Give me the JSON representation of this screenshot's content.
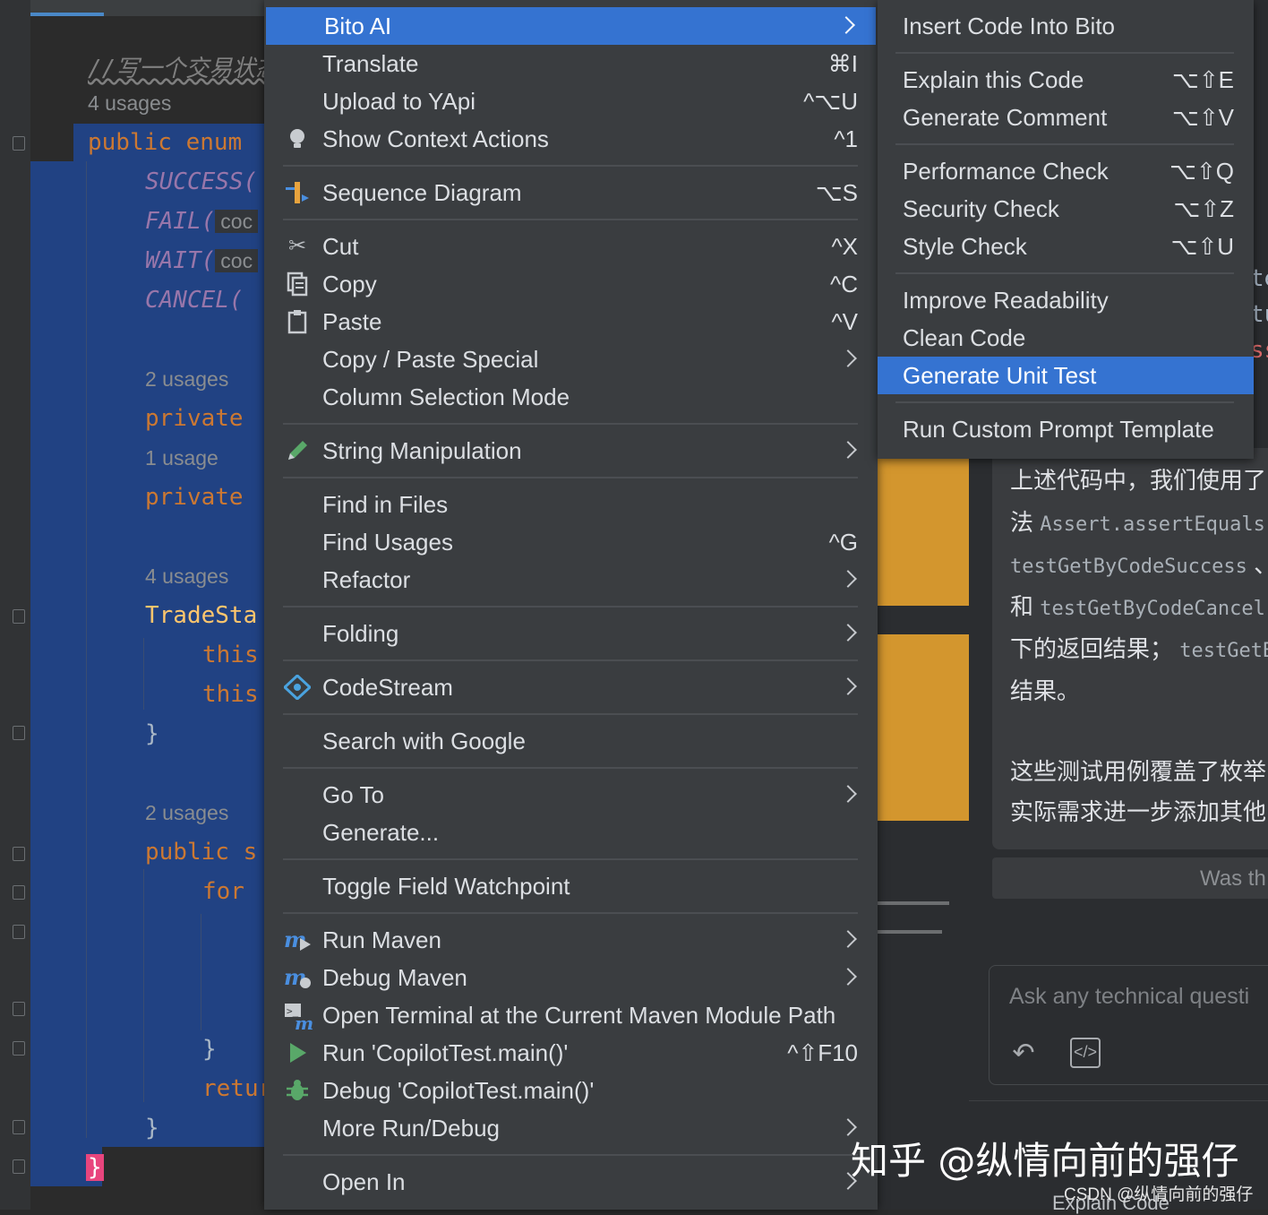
{
  "editor": {
    "comment": "//写一个交易状态",
    "usages": [
      "4 usages",
      "2 usages",
      "1 usage",
      "4 usages",
      "2 usages"
    ],
    "kw_public": "public",
    "kw_enum": "enum",
    "const_success": "SUCCESS(",
    "const_fail": "FAIL(",
    "const_wait": "WAIT(",
    "const_cancel": "CANCEL(",
    "hint_code": "coc",
    "kw_private": "private",
    "class_fragment": "TradeSta",
    "kw_this": "this",
    "kw_for": "for",
    "kw_return": "retur",
    "kw_public_s": "public s",
    "brace_close": "}"
  },
  "context_menu": {
    "items": [
      {
        "label": "Bito AI",
        "shortcut": "",
        "icon": "",
        "submenu": true
      },
      {
        "label": "Translate",
        "shortcut": "⌘I",
        "icon": ""
      },
      {
        "label": "Upload to YApi",
        "shortcut": "^⌥U",
        "icon": ""
      },
      {
        "label": "Show Context Actions",
        "shortcut": "^1",
        "icon": "lightbulb-icon"
      },
      {
        "label": "Sequence Diagram",
        "shortcut": "⌥S",
        "icon": "sequence-diagram-icon"
      },
      {
        "label": "Cut",
        "shortcut": "^X",
        "icon": "scissors-icon"
      },
      {
        "label": "Copy",
        "shortcut": "^C",
        "icon": "copy-icon"
      },
      {
        "label": "Paste",
        "shortcut": "^V",
        "icon": "clipboard-icon"
      },
      {
        "label": "Copy / Paste Special",
        "shortcut": "",
        "icon": "",
        "submenu": true
      },
      {
        "label": "Column Selection Mode",
        "shortcut": "",
        "icon": ""
      },
      {
        "label": "String Manipulation",
        "shortcut": "",
        "icon": "pencil-icon",
        "submenu": true
      },
      {
        "label": "Find in Files",
        "shortcut": "",
        "icon": ""
      },
      {
        "label": "Find Usages",
        "shortcut": "^G",
        "icon": ""
      },
      {
        "label": "Refactor",
        "shortcut": "",
        "icon": "",
        "submenu": true
      },
      {
        "label": "Folding",
        "shortcut": "",
        "icon": "",
        "submenu": true
      },
      {
        "label": "CodeStream",
        "shortcut": "",
        "icon": "codestream-icon",
        "submenu": true
      },
      {
        "label": "Search with Google",
        "shortcut": "",
        "icon": ""
      },
      {
        "label": "Go To",
        "shortcut": "",
        "icon": "",
        "submenu": true
      },
      {
        "label": "Generate...",
        "shortcut": "",
        "icon": ""
      },
      {
        "label": "Toggle Field Watchpoint",
        "shortcut": "",
        "icon": ""
      },
      {
        "label": "Run Maven",
        "shortcut": "",
        "icon": "maven-run-icon",
        "submenu": true
      },
      {
        "label": "Debug Maven",
        "shortcut": "",
        "icon": "maven-debug-icon",
        "submenu": true
      },
      {
        "label": "Open Terminal at the Current Maven Module Path",
        "shortcut": "",
        "icon": "maven-terminal-icon"
      },
      {
        "label": "Run 'CopilotTest.main()'",
        "shortcut": "^⇧F10",
        "icon": "run-icon"
      },
      {
        "label": "Debug 'CopilotTest.main()'",
        "shortcut": "",
        "icon": "debug-bug-icon"
      },
      {
        "label": "More Run/Debug",
        "shortcut": "",
        "icon": "",
        "submenu": true
      },
      {
        "label": "Open In",
        "shortcut": "",
        "icon": "",
        "submenu": true
      }
    ]
  },
  "bito_submenu": {
    "items": [
      {
        "label": "Insert Code Into Bito",
        "shortcut": ""
      },
      {
        "label": "Explain this Code",
        "shortcut": "⌥⇧E"
      },
      {
        "label": "Generate Comment",
        "shortcut": "⌥⇧V"
      },
      {
        "label": "Performance Check",
        "shortcut": "⌥⇧Q"
      },
      {
        "label": "Security Check",
        "shortcut": "⌥⇧Z"
      },
      {
        "label": "Style Check",
        "shortcut": "⌥⇧U"
      },
      {
        "label": "Improve Readability",
        "shortcut": ""
      },
      {
        "label": "Clean Code",
        "shortcut": ""
      },
      {
        "label": "Generate Unit Test",
        "shortcut": ""
      },
      {
        "label": "Run Custom Prompt Template",
        "shortcut": ""
      }
    ]
  },
  "bito_panel": {
    "answer_lines": {
      "l1": "上述代码中，我们使用了",
      "l2_pre": "法",
      "l2_code": "Assert.assertEquals",
      "l3_code": "testGetByCodeSuccess",
      "l3_post": "、",
      "l4_pre": "和",
      "l4_code": "testGetByCodeCancel",
      "l5_pre": "下的返回结果；",
      "l5_code": "testGetB",
      "l6": "结果。",
      "l7": "这些测试用例覆盖了枚举",
      "l8": "实际需求进一步添加其他"
    },
    "feedback_text": "Was th",
    "ask_placeholder": "Ask any technical questi",
    "side_fragments": [
      "te",
      "tu",
      "ss"
    ],
    "explain_code_label": "Explain Code"
  },
  "watermark": {
    "zhihu": "知乎 @纵情向前的强仔",
    "csdn": "CSDN @纵情向前的强仔"
  },
  "colors": {
    "menu_bg": "#3a3d40",
    "highlight": "#3573d1",
    "selection": "#214283",
    "keyword": "#cc7832",
    "enum_constant": "#9876aa"
  }
}
